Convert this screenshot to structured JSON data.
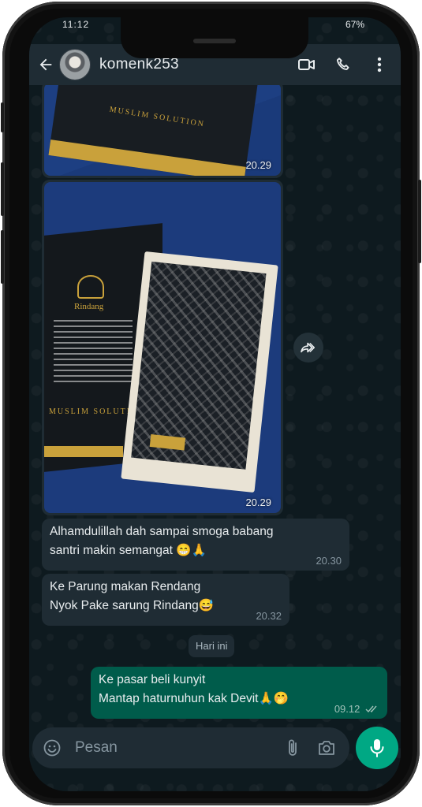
{
  "status_bar": {
    "time": "11:12",
    "battery": "67%"
  },
  "header": {
    "contact_name": "komenk253"
  },
  "messages": [
    {
      "type": "image",
      "direction": "in",
      "time": "20.29",
      "caption": "MUSLIM SOLUTION"
    },
    {
      "type": "image",
      "direction": "in",
      "time": "20.29",
      "caption": "MUSLIM SOLUTION",
      "brand": "Rindang"
    },
    {
      "type": "text",
      "direction": "in",
      "lines": [
        "Alhamdulillah dah sampai smoga babang",
        "santri makin semangat 😁🙏"
      ],
      "time": "20.30"
    },
    {
      "type": "text",
      "direction": "in",
      "lines": [
        "Ke Parung makan Rendang",
        "Nyok Pake sarung Rindang😅"
      ],
      "time": "20.32"
    },
    {
      "type": "text",
      "direction": "out",
      "lines": [
        "Ke pasar beli kunyit",
        "Mantap haturnuhun kak Devit🙏🤭"
      ],
      "time": "09.12",
      "status": "read"
    }
  ],
  "date_separator": "Hari ini",
  "composer": {
    "placeholder": "Pesan"
  },
  "colors": {
    "header": "#1f2c34",
    "incoming": "#1f2c34",
    "outgoing": "#005c4b",
    "accent": "#00a884",
    "background": "#0e1a1f"
  },
  "icons": [
    "back-arrow-icon",
    "video-call-icon",
    "phone-icon",
    "more-vertical-icon",
    "forward-icon",
    "emoji-icon",
    "attach-icon",
    "camera-icon",
    "mic-icon",
    "double-check-icon"
  ]
}
